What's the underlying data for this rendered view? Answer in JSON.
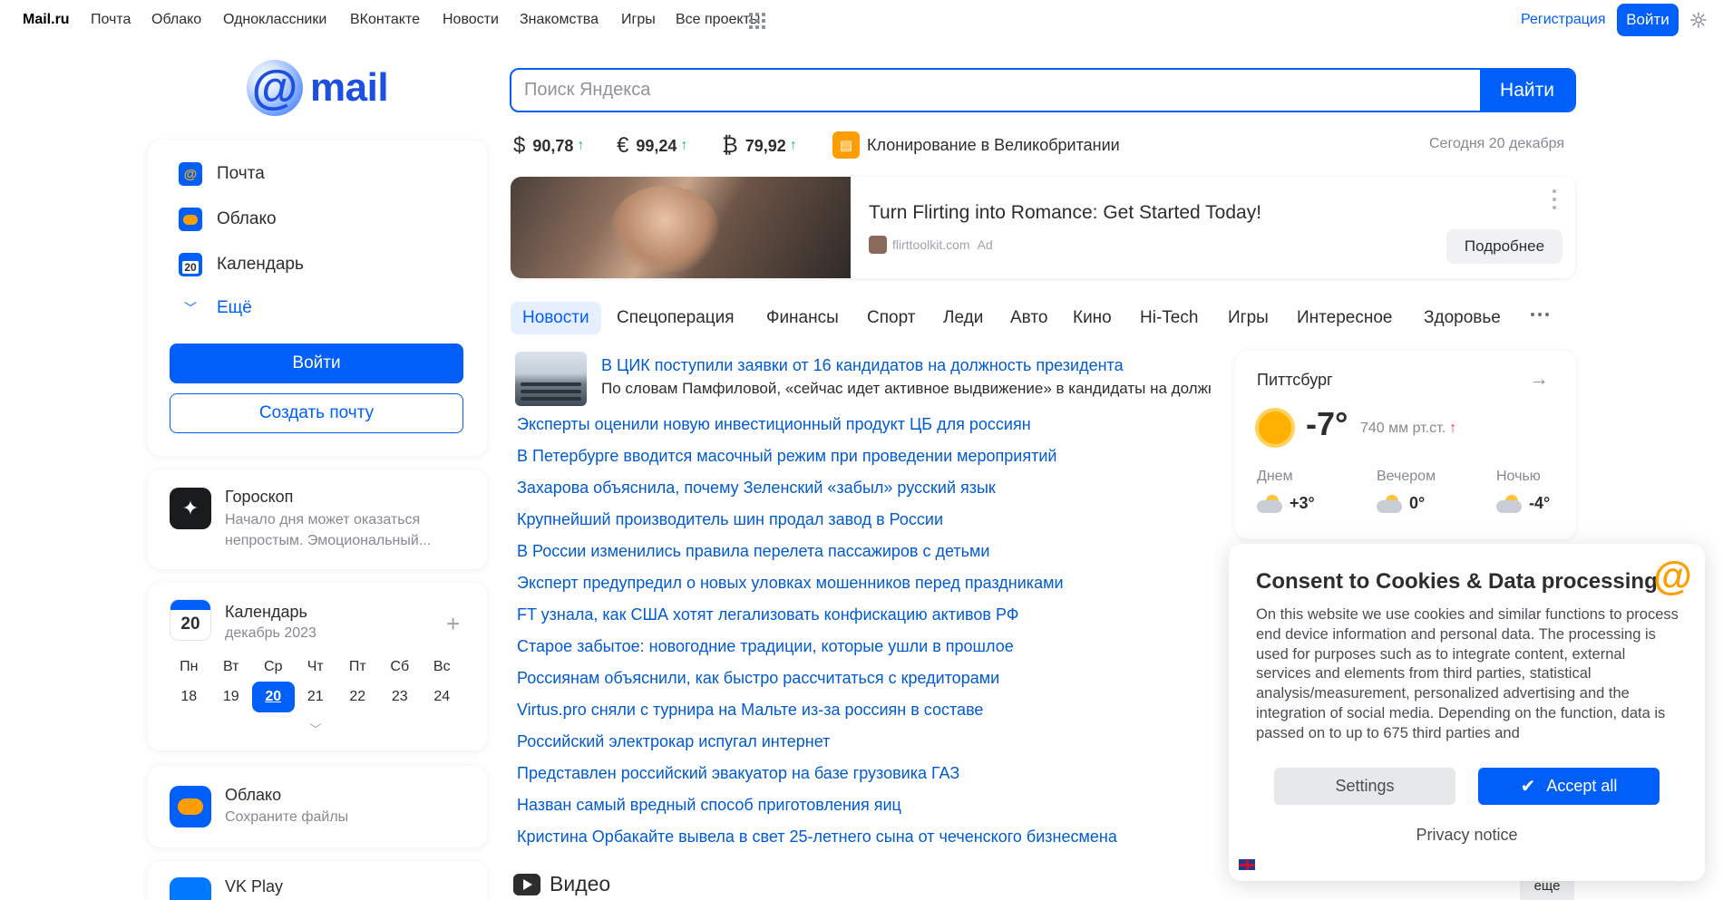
{
  "nav": {
    "brand": "Mail.ru",
    "items": [
      "Почта",
      "Облако",
      "Одноклассники",
      "ВКонтакте",
      "Новости",
      "Знакомства",
      "Игры",
      "Все проекты"
    ],
    "register": "Регистрация",
    "login": "Войти"
  },
  "logo": {
    "text": "mail"
  },
  "search": {
    "placeholder": "Поиск Яндекса",
    "button": "Найти"
  },
  "rates": [
    {
      "symbol": "$",
      "value": "90,78",
      "trend": "↑"
    },
    {
      "symbol": "€",
      "value": "99,24",
      "trend": "↑"
    },
    {
      "symbol": "₿",
      "value": "79,92",
      "trend": "↑"
    }
  ],
  "promo": {
    "text": "Клонирование в Великобритании"
  },
  "date_today": "Сегодня 20 декабря",
  "ad": {
    "title": "Turn Flirting into Romance: Get Started Today!",
    "domain": "flirttoolkit.com",
    "label": "Ad",
    "button": "Подробнее"
  },
  "tabs": [
    "Новости",
    "Спецоперация",
    "Финансы",
    "Спорт",
    "Леди",
    "Авто",
    "Кино",
    "Hi-Tech",
    "Игры",
    "Интересное",
    "Здоровье"
  ],
  "lead_news": {
    "title": "В ЦИК поступили заявки от 16 кандидатов на должность президента",
    "subtitle": "По словам Памфиловой, «сейчас идет активное выдвижение» в кандидаты на должность"
  },
  "news": [
    "Эксперты оценили новую инвестиционный продукт ЦБ для россиян",
    "В Петербурге вводится масочный режим при проведении мероприятий",
    "Захарова объяснила, почему Зеленский «забыл» русский язык",
    "Крупнейший производитель шин продал завод в России",
    "В России изменились правила перелета пассажиров с детьми",
    "Эксперт предупредил о новых уловках мошенников перед праздниками",
    "FT узнала, как США хотят легализовать конфискацию активов РФ",
    "Старое забытое: новогодние традиции, которые ушли в прошлое",
    "Россиянам объяснили, как быстро рассчитаться с кредиторами",
    "Virtus.pro сняли с турнира на Мальте из-за россиян в составе",
    "Российский электрокар испугал интернет",
    "Представлен российский эвакуатор на базе грузовика ГАЗ",
    "Назван самый вредный способ приготовления яиц",
    "Кристина Орбакайте вывела в свет 25-летнего сына от чеченского бизнесмена"
  ],
  "video": {
    "title": "Видео",
    "more": "еще"
  },
  "services": {
    "items": [
      "Почта",
      "Облако",
      "Календарь"
    ],
    "more": "Ещё",
    "calendar_icon_day": "20",
    "login": "Войти",
    "create": "Создать почту"
  },
  "horoscope": {
    "title": "Гороскоп",
    "text": "Начало дня может оказаться непростым. Эмоциональный..."
  },
  "calendar": {
    "title": "Календарь",
    "month": "декабрь 2023",
    "icon_day": "20",
    "weekdays": [
      "Пн",
      "Вт",
      "Ср",
      "Чт",
      "Пт",
      "Сб",
      "Вс"
    ],
    "days": [
      "18",
      "19",
      "20",
      "21",
      "22",
      "23",
      "24"
    ]
  },
  "cloud": {
    "title": "Облако",
    "text": "Сохраните файлы"
  },
  "vkplay": {
    "title": "VK Play"
  },
  "weather": {
    "city": "Питтсбург",
    "temp": "-7°",
    "pressure": "740 мм рт.ст.",
    "pressure_trend": "↑",
    "parts": [
      {
        "label": "Днем",
        "value": "+3°"
      },
      {
        "label": "Вечером",
        "value": "0°"
      },
      {
        "label": "Ночью",
        "value": "-4°"
      }
    ]
  },
  "consent": {
    "title": "Consent to Cookies & Data processing",
    "text": "On this website we use cookies and similar functions to process end device information and personal data. The processing is used for purposes such as to integrate content, external services and elements from third parties, statistical analysis/measurement, personalized advertising and the integration of social media. Depending on the function, data is passed on to up to 675 third parties and",
    "settings": "Settings",
    "accept": "Accept all",
    "privacy": "Privacy notice"
  },
  "colors": {
    "accent": "#005ff9",
    "link": "#005bd1",
    "up": "#0dc268",
    "consent_logo": "#ff9e00"
  }
}
